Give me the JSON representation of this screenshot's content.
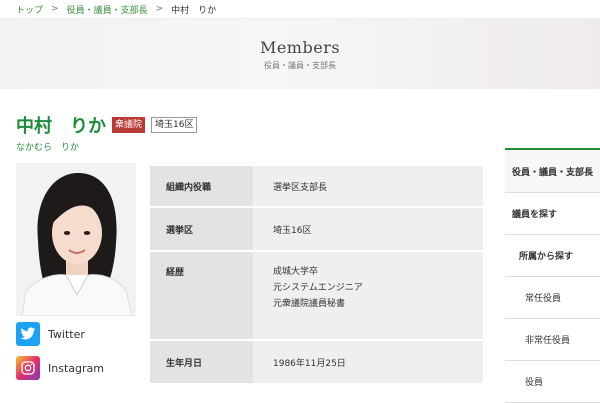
{
  "breadcrumb": {
    "items": [
      "トップ",
      "役員・議員・支部長",
      "中村　りか"
    ],
    "separator": ">"
  },
  "hero": {
    "title": "Members",
    "subtitle": "役員・議員・支部長"
  },
  "profile": {
    "name": "中村　りか",
    "kana": "なかむら　りか",
    "house_badge": "衆議院",
    "district_badge": "埼玉16区"
  },
  "info": {
    "rows": [
      {
        "label": "組織内役職",
        "lines": [
          "選挙区支部長"
        ]
      },
      {
        "label": "選挙区",
        "lines": [
          "埼玉16区"
        ]
      },
      {
        "label": "経歴",
        "lines": [
          "成城大学卒",
          "元システムエンジニア",
          "元衆議院議員秘書"
        ]
      },
      {
        "label": "生年月日",
        "lines": [
          "1986年11月25日"
        ]
      }
    ]
  },
  "social": {
    "twitter": "Twitter",
    "instagram": "Instagram"
  },
  "sidebar": {
    "heading": "役員・議員・支部長",
    "items": [
      "議員を探す",
      "所属から探す",
      "常任役員",
      "非常任役員",
      "役員"
    ]
  },
  "colors": {
    "brand_green": "#1f8b3b",
    "house_badge_red": "#b73a35",
    "twitter_blue": "#1da1f2"
  }
}
